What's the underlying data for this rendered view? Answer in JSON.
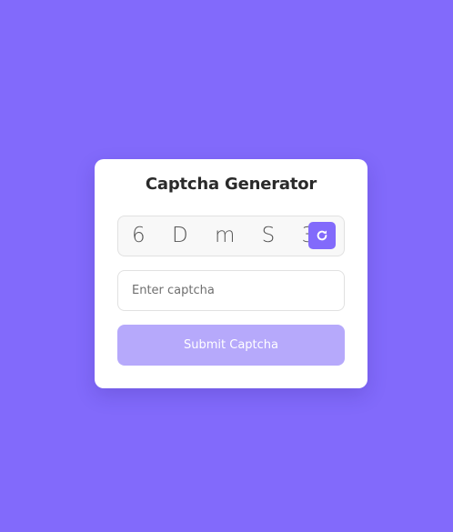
{
  "page": {
    "background_color": "#826afb"
  },
  "card": {
    "title": "Captcha Generator"
  },
  "captcha": {
    "text": "6 D m S 3",
    "refresh_icon": "refresh-icon"
  },
  "input": {
    "placeholder": "Enter captcha",
    "value": ""
  },
  "submit": {
    "label": "Submit Captcha",
    "color": "#b6a9fb"
  }
}
